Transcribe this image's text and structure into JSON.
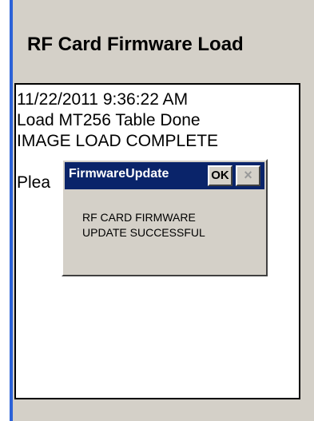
{
  "window": {
    "title": "RF Card Firmware Load"
  },
  "log": {
    "lines": [
      "11/22/2011 9:36:22 AM",
      "Load MT256 Table Done",
      "IMAGE LOAD COMPLETE",
      "",
      "Plea"
    ]
  },
  "dialog": {
    "title": "FirmwareUpdate",
    "ok_label": "OK",
    "close_label": "×",
    "message_lines": [
      "RF CARD FIRMWARE",
      "UPDATE SUCCESSFUL"
    ]
  },
  "colors": {
    "window_bg": "#d4d0c8",
    "accent_border": "#2c62d8",
    "dialog_titlebar": "#0a246a"
  }
}
